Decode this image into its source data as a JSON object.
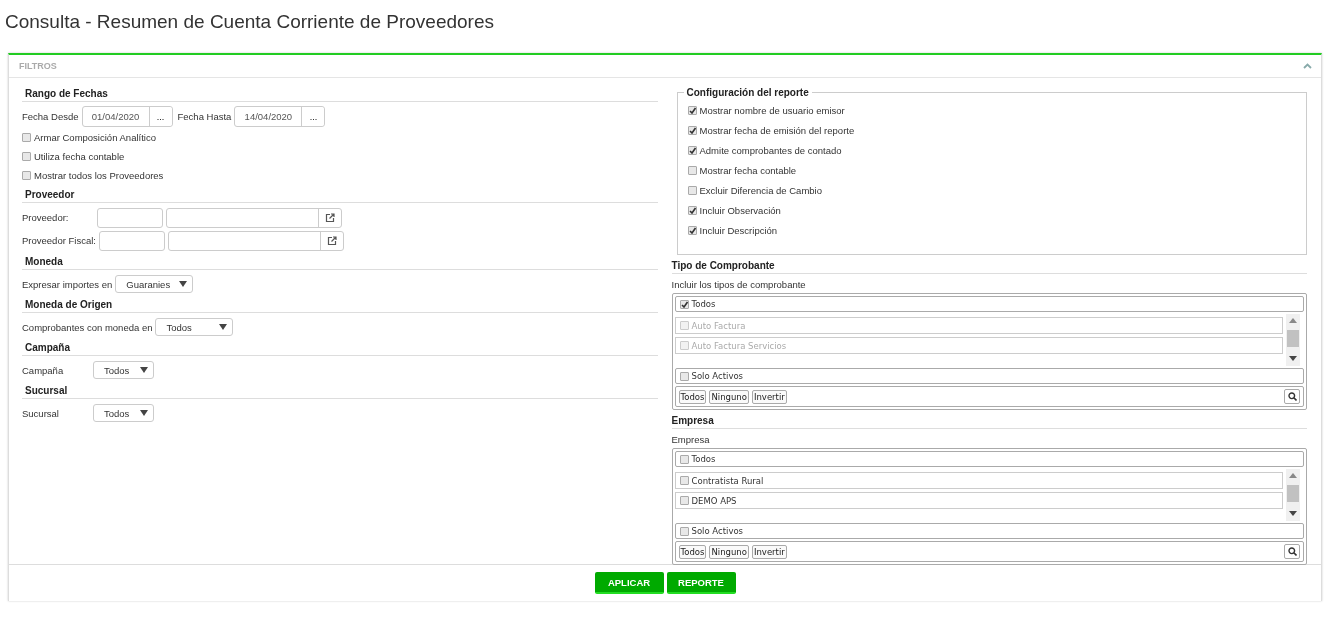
{
  "title": "Consulta - Resumen de Cuenta Corriente de Proveedores",
  "panel": {
    "title": "FILTROS",
    "expanded": true
  },
  "left_sections": [
    {
      "heading": "Rango de Fechas",
      "rows": [
        {
          "kind": "date_range",
          "from_label": "Fecha Desde",
          "from_value": "01/04/2020",
          "from_button": "...",
          "to_label": "Fecha Hasta",
          "to_value": "14/04/2020",
          "to_button": "..."
        },
        {
          "kind": "checkbox",
          "label": "Armar Composición Analítico",
          "checked": false
        },
        {
          "kind": "checkbox",
          "label": "Utiliza fecha contable",
          "checked": false
        },
        {
          "kind": "checkbox",
          "label": "Mostrar todos los Proveedores",
          "checked": false
        }
      ]
    },
    {
      "heading": "Proveedor",
      "rows": [
        {
          "kind": "lookup",
          "label": "Proveedor:"
        },
        {
          "kind": "lookup",
          "label": "Proveedor Fiscal:"
        }
      ]
    },
    {
      "heading": "Moneda",
      "rows": [
        {
          "kind": "select",
          "label": "Expresar importes en",
          "value": "Guaranies"
        }
      ]
    },
    {
      "heading": "Moneda de Origen",
      "rows": [
        {
          "kind": "select",
          "label": "Comprobantes con moneda en",
          "value": "Todos"
        }
      ]
    },
    {
      "heading": "Campaña",
      "rows": [
        {
          "kind": "select",
          "label": "Campaña",
          "value": "Todos"
        }
      ]
    },
    {
      "heading": "Sucursal",
      "rows": [
        {
          "kind": "select",
          "label": "Sucursal",
          "value": "Todos"
        }
      ]
    }
  ],
  "report_config": {
    "legend": "Configuración del reporte",
    "options": [
      {
        "label": "Mostrar nombre de usuario emisor",
        "checked": true
      },
      {
        "label": "Mostrar fecha de emisión del reporte",
        "checked": true
      },
      {
        "label": "Admite comprobantes de contado",
        "checked": true
      },
      {
        "label": "Mostrar fecha contable",
        "checked": false
      },
      {
        "label": "Excluir Diferencia de Cambio",
        "checked": false
      },
      {
        "label": "Incluir Observación",
        "checked": true
      },
      {
        "label": "Incluir Descripción",
        "checked": true
      }
    ]
  },
  "pickers": [
    {
      "heading": "Tipo de Comprobante",
      "caption": "Incluir los tipos de comprobante",
      "all": {
        "label": "Todos",
        "checked": true
      },
      "items": [
        {
          "label": "Auto Factura",
          "checked": false,
          "disabled": true
        },
        {
          "label": "Auto Factura Servicios",
          "checked": false,
          "disabled": true
        }
      ],
      "only_active": {
        "label": "Solo Activos",
        "checked": false
      },
      "actions": [
        "Todos",
        "Ninguno",
        "Invertir"
      ]
    },
    {
      "heading": "Empresa",
      "caption": "Empresa",
      "all": {
        "label": "Todos",
        "checked": false
      },
      "items": [
        {
          "label": "Contratista Rural",
          "checked": false,
          "disabled": false
        },
        {
          "label": "DEMO APS",
          "checked": false,
          "disabled": false
        }
      ],
      "only_active": {
        "label": "Solo Activos",
        "checked": false
      },
      "actions": [
        "Todos",
        "Ninguno",
        "Invertir"
      ]
    }
  ],
  "buttons": [
    "APLICAR",
    "REPORTE"
  ]
}
